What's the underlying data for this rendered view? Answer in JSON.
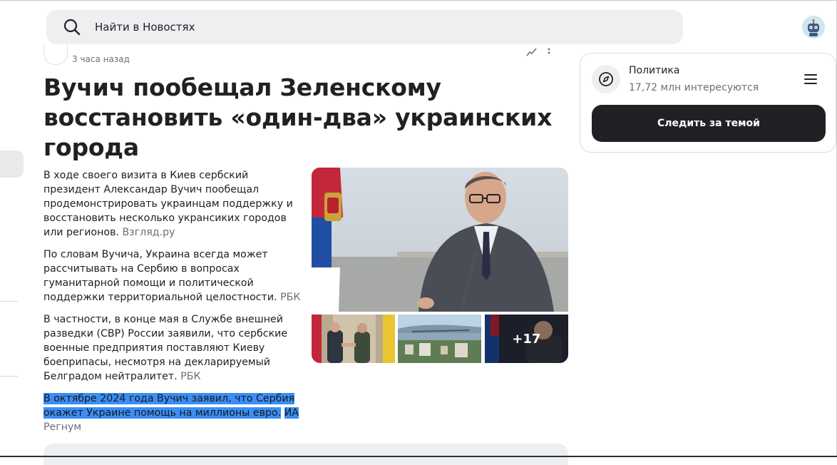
{
  "search": {
    "placeholder": "Найти в Новостях"
  },
  "article": {
    "time": "3 часа назад",
    "title": "Вучич пообещал Зеленскому восстановить «один-два» украинских города",
    "paragraphs": [
      {
        "text": "В ходе своего визита в Киев сербский президент Александар Вучич пообещал продемонстрировать украинцам поддержку и восстановить несколько укрансиких городов или регионов.",
        "source": "Взгляд.ру"
      },
      {
        "text": "По словам Вучича, Украина всегда может рассчитывать на Сербию в вопросах гуманитарной помощи и политической поддержки территориальной целостности.",
        "source": "РБК"
      },
      {
        "text": "В частности, в конце мая в Службе внешней разведки (СВР) России заявили, что сербские военные предприятия поставляют Киеву боеприпасы, несмотря на декларируемый Белградом нейтралитет.",
        "source": "РБК"
      },
      {
        "text": "В октябре 2024 года Вучич заявил, что Сербия окажет Украине помощь на миллионы евро.",
        "source_part1": "ИА",
        "source_part2": "Регнум"
      }
    ],
    "more_photos": "+17"
  },
  "topic": {
    "name": "Политика",
    "followers": "17,72 млн интересуются",
    "follow_label": "Следить за темой"
  },
  "colors": {
    "highlight": "#3a8ef6",
    "button": "#202124",
    "search_bg": "#eeeff1"
  }
}
